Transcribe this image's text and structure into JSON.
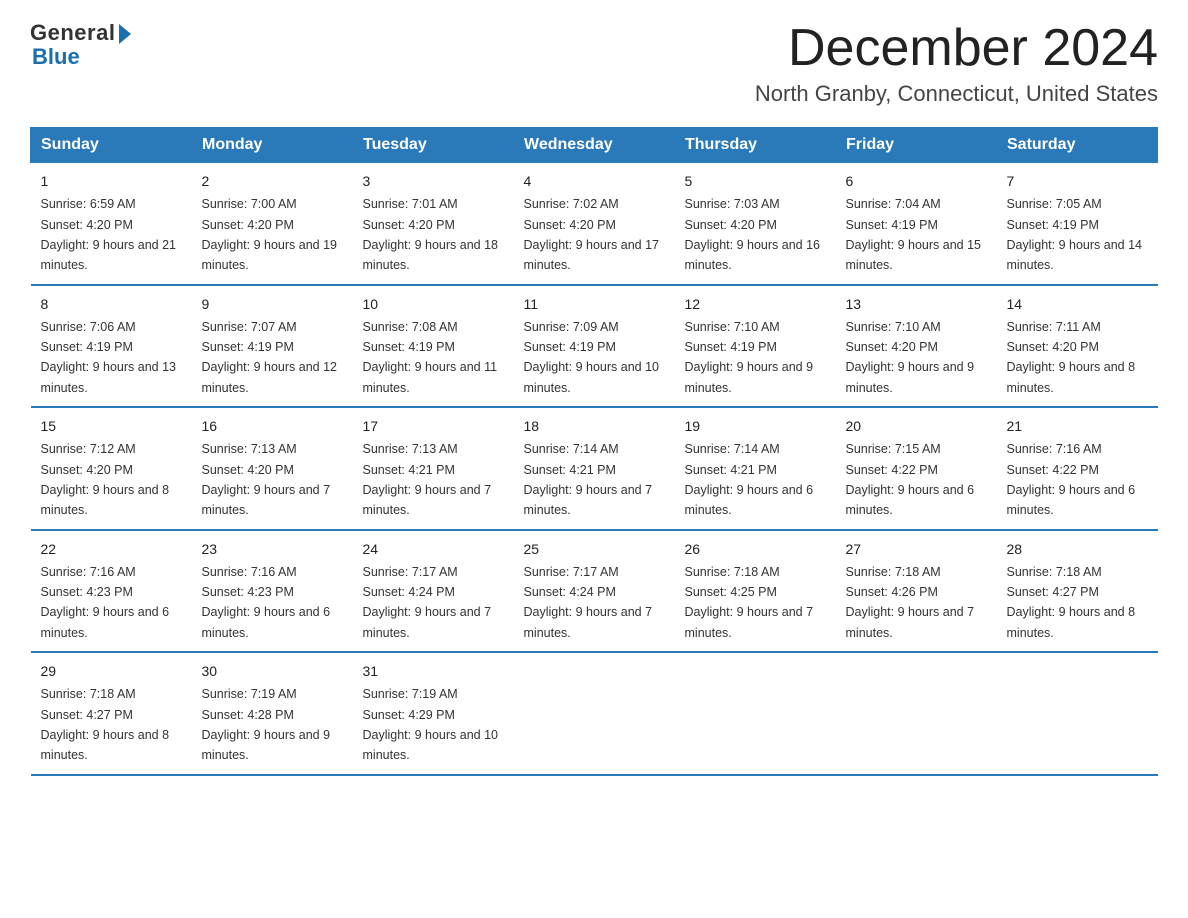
{
  "header": {
    "logo_general": "General",
    "logo_blue": "Blue",
    "month_year": "December 2024",
    "location": "North Granby, Connecticut, United States"
  },
  "days_of_week": [
    "Sunday",
    "Monday",
    "Tuesday",
    "Wednesday",
    "Thursday",
    "Friday",
    "Saturday"
  ],
  "weeks": [
    [
      {
        "day": "1",
        "sunrise": "6:59 AM",
        "sunset": "4:20 PM",
        "daylight": "9 hours and 21 minutes."
      },
      {
        "day": "2",
        "sunrise": "7:00 AM",
        "sunset": "4:20 PM",
        "daylight": "9 hours and 19 minutes."
      },
      {
        "day": "3",
        "sunrise": "7:01 AM",
        "sunset": "4:20 PM",
        "daylight": "9 hours and 18 minutes."
      },
      {
        "day": "4",
        "sunrise": "7:02 AM",
        "sunset": "4:20 PM",
        "daylight": "9 hours and 17 minutes."
      },
      {
        "day": "5",
        "sunrise": "7:03 AM",
        "sunset": "4:20 PM",
        "daylight": "9 hours and 16 minutes."
      },
      {
        "day": "6",
        "sunrise": "7:04 AM",
        "sunset": "4:19 PM",
        "daylight": "9 hours and 15 minutes."
      },
      {
        "day": "7",
        "sunrise": "7:05 AM",
        "sunset": "4:19 PM",
        "daylight": "9 hours and 14 minutes."
      }
    ],
    [
      {
        "day": "8",
        "sunrise": "7:06 AM",
        "sunset": "4:19 PM",
        "daylight": "9 hours and 13 minutes."
      },
      {
        "day": "9",
        "sunrise": "7:07 AM",
        "sunset": "4:19 PM",
        "daylight": "9 hours and 12 minutes."
      },
      {
        "day": "10",
        "sunrise": "7:08 AM",
        "sunset": "4:19 PM",
        "daylight": "9 hours and 11 minutes."
      },
      {
        "day": "11",
        "sunrise": "7:09 AM",
        "sunset": "4:19 PM",
        "daylight": "9 hours and 10 minutes."
      },
      {
        "day": "12",
        "sunrise": "7:10 AM",
        "sunset": "4:19 PM",
        "daylight": "9 hours and 9 minutes."
      },
      {
        "day": "13",
        "sunrise": "7:10 AM",
        "sunset": "4:20 PM",
        "daylight": "9 hours and 9 minutes."
      },
      {
        "day": "14",
        "sunrise": "7:11 AM",
        "sunset": "4:20 PM",
        "daylight": "9 hours and 8 minutes."
      }
    ],
    [
      {
        "day": "15",
        "sunrise": "7:12 AM",
        "sunset": "4:20 PM",
        "daylight": "9 hours and 8 minutes."
      },
      {
        "day": "16",
        "sunrise": "7:13 AM",
        "sunset": "4:20 PM",
        "daylight": "9 hours and 7 minutes."
      },
      {
        "day": "17",
        "sunrise": "7:13 AM",
        "sunset": "4:21 PM",
        "daylight": "9 hours and 7 minutes."
      },
      {
        "day": "18",
        "sunrise": "7:14 AM",
        "sunset": "4:21 PM",
        "daylight": "9 hours and 7 minutes."
      },
      {
        "day": "19",
        "sunrise": "7:14 AM",
        "sunset": "4:21 PM",
        "daylight": "9 hours and 6 minutes."
      },
      {
        "day": "20",
        "sunrise": "7:15 AM",
        "sunset": "4:22 PM",
        "daylight": "9 hours and 6 minutes."
      },
      {
        "day": "21",
        "sunrise": "7:16 AM",
        "sunset": "4:22 PM",
        "daylight": "9 hours and 6 minutes."
      }
    ],
    [
      {
        "day": "22",
        "sunrise": "7:16 AM",
        "sunset": "4:23 PM",
        "daylight": "9 hours and 6 minutes."
      },
      {
        "day": "23",
        "sunrise": "7:16 AM",
        "sunset": "4:23 PM",
        "daylight": "9 hours and 6 minutes."
      },
      {
        "day": "24",
        "sunrise": "7:17 AM",
        "sunset": "4:24 PM",
        "daylight": "9 hours and 7 minutes."
      },
      {
        "day": "25",
        "sunrise": "7:17 AM",
        "sunset": "4:24 PM",
        "daylight": "9 hours and 7 minutes."
      },
      {
        "day": "26",
        "sunrise": "7:18 AM",
        "sunset": "4:25 PM",
        "daylight": "9 hours and 7 minutes."
      },
      {
        "day": "27",
        "sunrise": "7:18 AM",
        "sunset": "4:26 PM",
        "daylight": "9 hours and 7 minutes."
      },
      {
        "day": "28",
        "sunrise": "7:18 AM",
        "sunset": "4:27 PM",
        "daylight": "9 hours and 8 minutes."
      }
    ],
    [
      {
        "day": "29",
        "sunrise": "7:18 AM",
        "sunset": "4:27 PM",
        "daylight": "9 hours and 8 minutes."
      },
      {
        "day": "30",
        "sunrise": "7:19 AM",
        "sunset": "4:28 PM",
        "daylight": "9 hours and 9 minutes."
      },
      {
        "day": "31",
        "sunrise": "7:19 AM",
        "sunset": "4:29 PM",
        "daylight": "9 hours and 10 minutes."
      },
      {
        "day": "",
        "sunrise": "",
        "sunset": "",
        "daylight": ""
      },
      {
        "day": "",
        "sunrise": "",
        "sunset": "",
        "daylight": ""
      },
      {
        "day": "",
        "sunrise": "",
        "sunset": "",
        "daylight": ""
      },
      {
        "day": "",
        "sunrise": "",
        "sunset": "",
        "daylight": ""
      }
    ]
  ],
  "labels": {
    "sunrise_prefix": "Sunrise: ",
    "sunset_prefix": "Sunset: ",
    "daylight_prefix": "Daylight: "
  }
}
